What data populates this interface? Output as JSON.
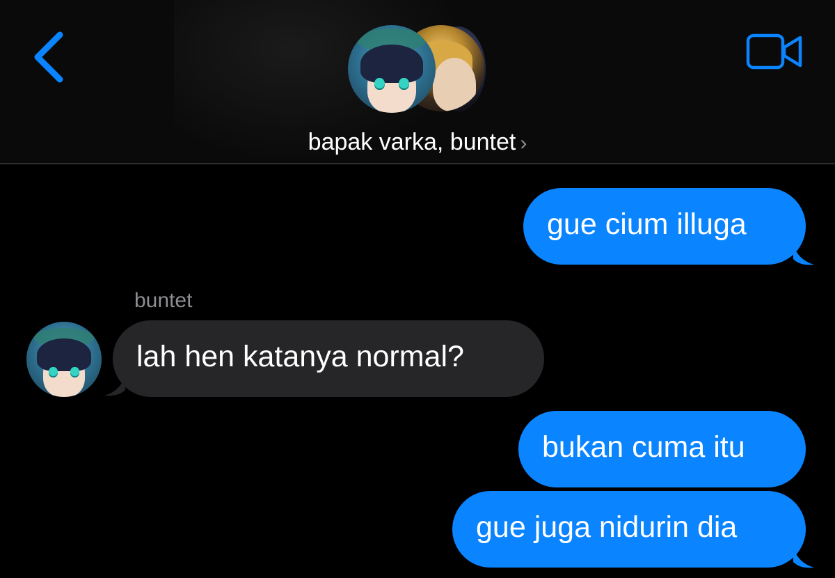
{
  "header": {
    "title": "bapak varka, buntet",
    "title_chevron": "›",
    "back_icon": "chevron-left-icon",
    "video_icon": "video-camera-icon",
    "accent_color": "#0a84ff"
  },
  "messages": [
    {
      "direction": "outgoing",
      "text": "gue cium illuga"
    },
    {
      "direction": "incoming",
      "sender": "buntet",
      "text": "lah hen katanya normal?"
    },
    {
      "direction": "outgoing",
      "text": "bukan cuma itu"
    },
    {
      "direction": "outgoing",
      "text": "gue juga nidurin dia"
    }
  ],
  "colors": {
    "background": "#000000",
    "outgoing_bubble": "#0a84ff",
    "incoming_bubble": "#262629",
    "secondary_text": "#8e8e93"
  }
}
